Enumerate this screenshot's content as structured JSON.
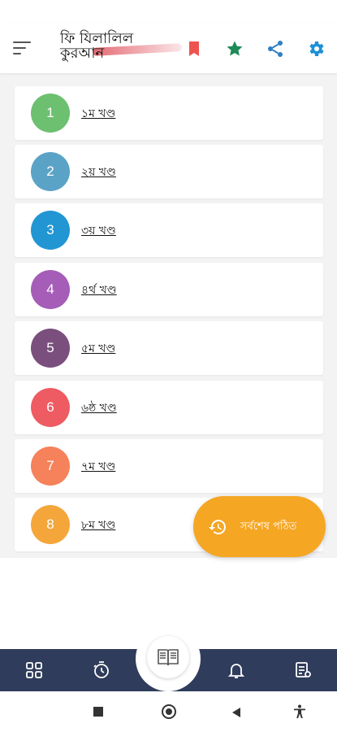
{
  "app": {
    "title_line1": "ফি যিলালিল",
    "title_line2": "কুরআন"
  },
  "colors": {
    "bookmark": "#ef5350",
    "star": "#1e8a57",
    "share": "#2f7fc1",
    "settings": "#1e90d6",
    "fab": "#f5a623",
    "bottom_nav": "#2f3c5b"
  },
  "toolbar": {
    "icons": [
      "menu-icon",
      "bookmark-icon",
      "star-icon",
      "share-icon",
      "gear-icon"
    ]
  },
  "volumes": [
    {
      "number": "1",
      "label": "১ম খণ্ড",
      "color": "#6cc070"
    },
    {
      "number": "2",
      "label": "২য় খণ্ড",
      "color": "#5ba3c6"
    },
    {
      "number": "3",
      "label": "৩য় খণ্ড",
      "color": "#2196d3"
    },
    {
      "number": "4",
      "label": "৪র্থ খণ্ড",
      "color": "#a55db8"
    },
    {
      "number": "5",
      "label": "৫ম খণ্ড",
      "color": "#7a4f7e"
    },
    {
      "number": "6",
      "label": "৬ষ্ঠ খণ্ড",
      "color": "#ef5b63"
    },
    {
      "number": "7",
      "label": "৭ম খণ্ড",
      "color": "#f5825a"
    },
    {
      "number": "8",
      "label": "৮ম খণ্ড",
      "color": "#f5a63b"
    }
  ],
  "fab": {
    "label": "সর্বশেষ পঠিত",
    "icon": "history-icon"
  },
  "bottom_nav": {
    "items": [
      "grid-icon",
      "timer-icon",
      "book-icon",
      "bell-icon",
      "notes-icon"
    ]
  },
  "system_nav": {
    "items": [
      "recents-icon",
      "home-icon",
      "back-icon",
      "accessibility-icon"
    ]
  }
}
